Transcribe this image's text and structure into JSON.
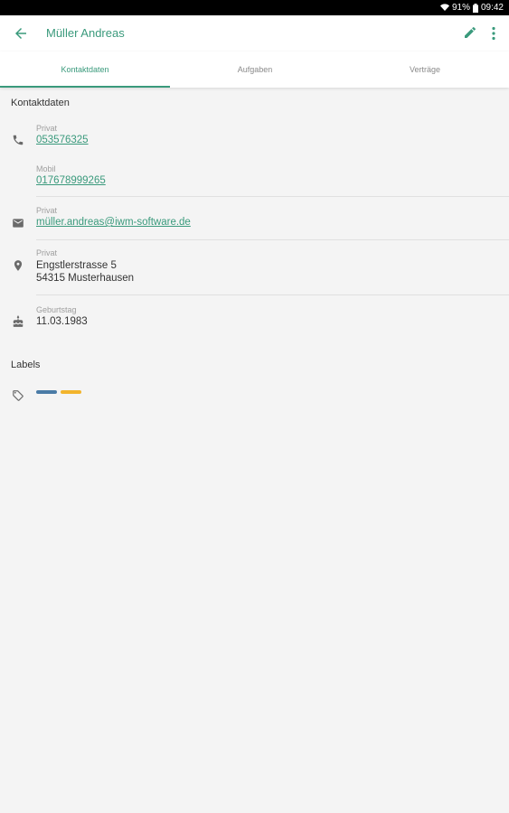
{
  "status_bar": {
    "battery": "91%",
    "time": "09:42"
  },
  "app_bar": {
    "title": "Müller Andreas"
  },
  "tabs": [
    {
      "label": "Kontaktdaten",
      "active": true
    },
    {
      "label": "Aufgaben",
      "active": false
    },
    {
      "label": "Verträge",
      "active": false
    }
  ],
  "contact": {
    "section_title": "Kontaktdaten",
    "phone_private_label": "Privat",
    "phone_private": "053576325",
    "phone_mobile_label": "Mobil",
    "phone_mobile": "017678999265",
    "email_label": "Privat",
    "email": "müller.andreas@iwm-software.de",
    "address_label": "Privat",
    "address_line1": "Engstlerstrasse 5",
    "address_line2": "54315 Musterhausen",
    "birthday_label": "Geburtstag",
    "birthday": "11.03.1983"
  },
  "labels": {
    "section_title": "Labels",
    "chips": [
      {
        "color": "#4a7ba6"
      },
      {
        "color": "#f2b42c"
      }
    ]
  },
  "colors": {
    "accent": "#3a9a7c",
    "background": "#f4f4f4"
  },
  "icons": [
    "wifi-icon",
    "battery-icon",
    "back-arrow-icon",
    "edit-icon",
    "more-icon",
    "phone-icon",
    "email-icon",
    "location-icon",
    "birthday-cake-icon",
    "label-icon"
  ]
}
